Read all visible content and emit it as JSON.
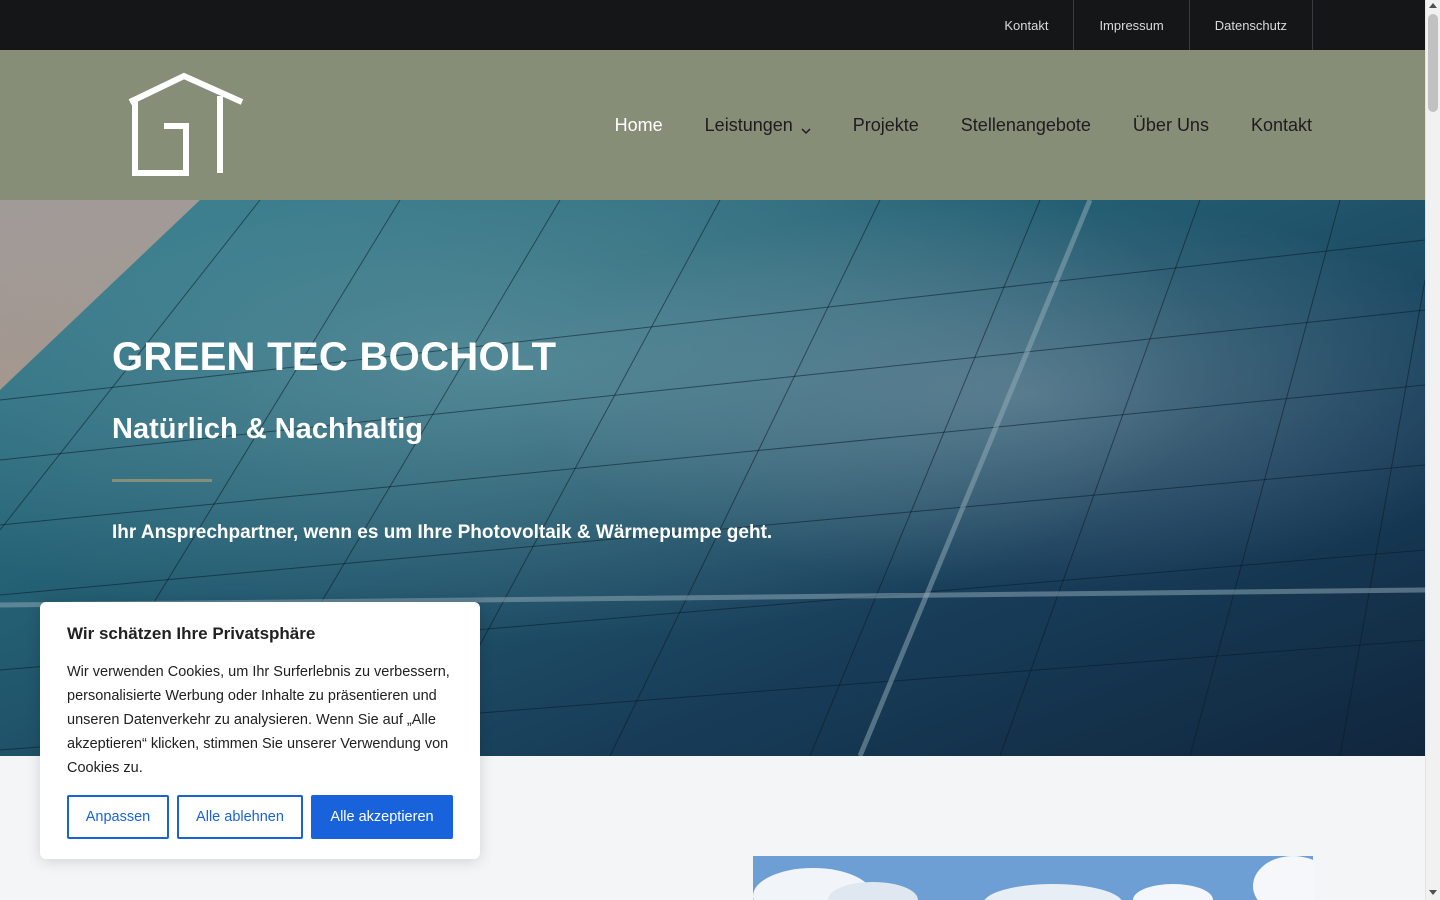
{
  "topbar": {
    "links": [
      "Kontakt",
      "Impressum",
      "Datenschutz"
    ]
  },
  "header": {
    "nav": [
      {
        "label": "Home",
        "active": true,
        "dropdown": false
      },
      {
        "label": "Leistungen",
        "active": false,
        "dropdown": true
      },
      {
        "label": "Projekte",
        "active": false,
        "dropdown": false
      },
      {
        "label": "Stellenangebote",
        "active": false,
        "dropdown": false
      },
      {
        "label": "Über Uns",
        "active": false,
        "dropdown": false
      },
      {
        "label": "Kontakt",
        "active": false,
        "dropdown": false
      }
    ],
    "logo_icon": "gt-house-logo-icon",
    "background_color": "#868e78"
  },
  "hero": {
    "title": "GREEN TEC BOCHOLT",
    "subtitle": "Natürlich & Nachhaltig",
    "text": "Ihr Ansprechpartner, wenn es um Ihre Photovoltaik & Wärmepumpe geht."
  },
  "cookie": {
    "title": "Wir schätzen Ihre Privatsphäre",
    "text": "Wir verwenden Cookies, um Ihr Surferlebnis zu verbessern, personalisierte Werbung oder Inhalte zu präsentieren und unseren Datenverkehr zu analysieren. Wenn Sie auf „Alle akzeptieren“ klicken, stimmen Sie unserer Verwendung von Cookies zu.",
    "btn_customize": "Anpassen",
    "btn_reject": "Alle ablehnen",
    "btn_accept": "Alle akzeptieren",
    "accent_color": "#1863dc"
  }
}
